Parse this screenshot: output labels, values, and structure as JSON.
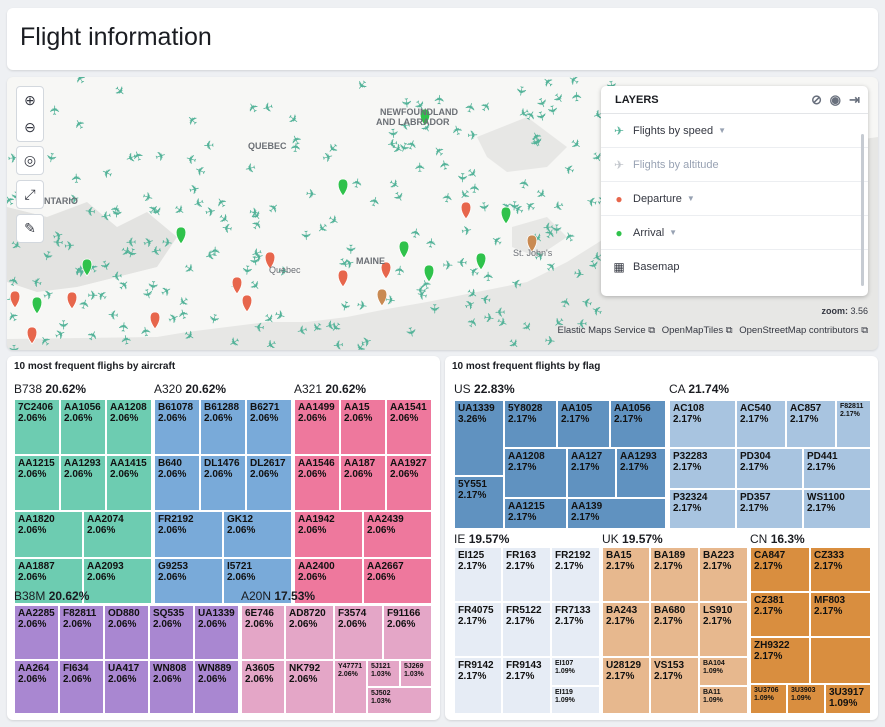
{
  "title": "Flight information",
  "map": {
    "labels": {
      "quebec": "QUEBEC",
      "ontario": "ONTARIO",
      "newfoundland": "NEWFOUNDLAND",
      "labrador": "AND LABRADOR",
      "maine": "MAINE",
      "stjohns": "St. John's",
      "quebec_city": "Quebec"
    },
    "zoom_label": "zoom:",
    "zoom_value": "3.56",
    "attributions": [
      "Elastic Maps Service",
      "OpenMapTiles",
      "OpenStreetMap contributors"
    ],
    "colors": {
      "plane": "#54b399",
      "departure": "#e7664c",
      "arrival": "#2fc24b",
      "water": "#e7e7e5",
      "land": "#f7f7f5"
    }
  },
  "layers": {
    "title": "LAYERS",
    "items": [
      {
        "label": "Flights by speed",
        "icon": "plane-icon"
      },
      {
        "label": "Flights by altitude",
        "icon": "plane-icon"
      },
      {
        "label": "Departure",
        "icon": "map-pin-icon"
      },
      {
        "label": "Arrival",
        "icon": "map-pin-icon"
      },
      {
        "label": "Basemap",
        "icon": "grid-icon"
      }
    ]
  },
  "aircraft": {
    "title": "10 most frequent flighs by aircraft",
    "groups": [
      {
        "name": "B738",
        "pct": "20.62%",
        "color": "#6dccb1",
        "cells": [
          {
            "l": "7C2406",
            "v": "2.06%"
          },
          {
            "l": "AA1056",
            "v": "2.06%"
          },
          {
            "l": "AA1208",
            "v": "2.06%"
          },
          {
            "l": "AA1215",
            "v": "2.06%"
          },
          {
            "l": "AA1293",
            "v": "2.06%"
          },
          {
            "l": "AA1415",
            "v": "2.06%"
          },
          {
            "l": "AA1820",
            "v": "2.06%"
          },
          {
            "l": "AA2074",
            "v": "2.06%"
          },
          {
            "l": "AA1887",
            "v": "2.06%"
          },
          {
            "l": "AA2093",
            "v": "2.06%"
          }
        ]
      },
      {
        "name": "A320",
        "pct": "20.62%",
        "color": "#79aad9",
        "cells": [
          {
            "l": "B61078",
            "v": "2.06%"
          },
          {
            "l": "B61288",
            "v": "2.06%"
          },
          {
            "l": "B6271",
            "v": "2.06%"
          },
          {
            "l": "B640",
            "v": "2.06%"
          },
          {
            "l": "DL1476",
            "v": "2.06%"
          },
          {
            "l": "DL2617",
            "v": "2.06%"
          },
          {
            "l": "FR2192",
            "v": "2.06%"
          },
          {
            "l": "GK12",
            "v": "2.06%"
          },
          {
            "l": "G9253",
            "v": "2.06%"
          },
          {
            "l": "I5721",
            "v": "2.06%"
          }
        ]
      },
      {
        "name": "A321",
        "pct": "20.62%",
        "color": "#ee789d",
        "cells": [
          {
            "l": "AA1499",
            "v": "2.06%"
          },
          {
            "l": "AA15",
            "v": "2.06%"
          },
          {
            "l": "AA1541",
            "v": "2.06%"
          },
          {
            "l": "AA1546",
            "v": "2.06%"
          },
          {
            "l": "AA187",
            "v": "2.06%"
          },
          {
            "l": "AA1927",
            "v": "2.06%"
          },
          {
            "l": "AA1942",
            "v": "2.06%"
          },
          {
            "l": "AA2439",
            "v": "2.06%"
          },
          {
            "l": "AA2400",
            "v": "2.06%"
          },
          {
            "l": "AA2667",
            "v": "2.06%"
          }
        ]
      },
      {
        "name": "B38M",
        "pct": "20.62%",
        "color": "#a987d1",
        "cells": [
          {
            "l": "AA2285",
            "v": "2.06%"
          },
          {
            "l": "F82811",
            "v": "2.06%"
          },
          {
            "l": "OD880",
            "v": "2.06%"
          },
          {
            "l": "SQ535",
            "v": "2.06%"
          },
          {
            "l": "UA1339",
            "v": "2.06%"
          },
          {
            "l": "AA264",
            "v": "2.06%"
          },
          {
            "l": "FI634",
            "v": "2.06%"
          },
          {
            "l": "UA417",
            "v": "2.06%"
          },
          {
            "l": "WN808",
            "v": "2.06%"
          },
          {
            "l": "WN889",
            "v": "2.06%"
          }
        ]
      },
      {
        "name": "A20N",
        "pct": "17.53%",
        "color": "#e4a6c7",
        "cells": [
          {
            "l": "6E746",
            "v": "2.06%"
          },
          {
            "l": "AD8720",
            "v": "2.06%"
          },
          {
            "l": "F3574",
            "v": "2.06%"
          },
          {
            "l": "F91166",
            "v": "2.06%"
          },
          {
            "l": "NK792",
            "v": "2.06%"
          },
          {
            "l": "Y47771",
            "v": "2.06%"
          },
          {
            "l": "5J121",
            "v": "1.03%"
          },
          {
            "l": "5J269",
            "v": "1.03%"
          },
          {
            "l": "A3605",
            "v": "2.06%"
          },
          {
            "l": "5J502",
            "v": "1.03%"
          }
        ]
      }
    ]
  },
  "flag": {
    "title": "10 most frequent flights by flag",
    "groups": [
      {
        "name": "US",
        "pct": "22.83%",
        "color": "#6092c0",
        "cells": [
          {
            "l": "UA1339",
            "v": "3.26%"
          },
          {
            "l": "5Y8028",
            "v": "2.17%"
          },
          {
            "l": "AA105",
            "v": "2.17%"
          },
          {
            "l": "AA1056",
            "v": "2.17%"
          },
          {
            "l": "AA1208",
            "v": "2.17%"
          },
          {
            "l": "AA127",
            "v": "2.17%"
          },
          {
            "l": "AA1293",
            "v": "2.17%"
          },
          {
            "l": "5Y551",
            "v": "2.17%"
          },
          {
            "l": "AA1215",
            "v": "2.17%"
          },
          {
            "l": "AA139",
            "v": "2.17%"
          }
        ]
      },
      {
        "name": "CA",
        "pct": "21.74%",
        "color": "#a8c4e0",
        "cells": [
          {
            "l": "AC108",
            "v": "2.17%"
          },
          {
            "l": "AC540",
            "v": "2.17%"
          },
          {
            "l": "AC857",
            "v": "2.17%"
          },
          {
            "l": "F82811",
            "v": "2.17%"
          },
          {
            "l": "P32283",
            "v": "2.17%"
          },
          {
            "l": "PD304",
            "v": "2.17%"
          },
          {
            "l": "PD441",
            "v": "2.17%"
          },
          {
            "l": "P32324",
            "v": "2.17%"
          },
          {
            "l": "PD357",
            "v": "2.17%"
          },
          {
            "l": "WS1100",
            "v": "2.17%"
          }
        ]
      },
      {
        "name": "IE",
        "pct": "19.57%",
        "color": "#e6ecf5",
        "cells": [
          {
            "l": "EI125",
            "v": "2.17%"
          },
          {
            "l": "FR163",
            "v": "2.17%"
          },
          {
            "l": "FR2192",
            "v": "2.17%"
          },
          {
            "l": "FR4075",
            "v": "2.17%"
          },
          {
            "l": "FR5122",
            "v": "2.17%"
          },
          {
            "l": "FR7133",
            "v": "2.17%"
          },
          {
            "l": "FR9142",
            "v": "2.17%"
          },
          {
            "l": "FR9143",
            "v": "2.17%"
          },
          {
            "l": "EI107",
            "v": "1.09%"
          },
          {
            "l": "EI119",
            "v": "1.09%"
          }
        ]
      },
      {
        "name": "UK",
        "pct": "19.57%",
        "color": "#e7b88e",
        "cells": [
          {
            "l": "BA15",
            "v": "2.17%"
          },
          {
            "l": "BA189",
            "v": "2.17%"
          },
          {
            "l": "BA223",
            "v": "2.17%"
          },
          {
            "l": "BA243",
            "v": "2.17%"
          },
          {
            "l": "BA680",
            "v": "2.17%"
          },
          {
            "l": "LS910",
            "v": "2.17%"
          },
          {
            "l": "U28129",
            "v": "2.17%"
          },
          {
            "l": "VS153",
            "v": "2.17%"
          },
          {
            "l": "BA104",
            "v": "1.09%"
          },
          {
            "l": "BA11",
            "v": "1.09%"
          }
        ]
      },
      {
        "name": "CN",
        "pct": "16.3%",
        "color": "#d98e3f",
        "cells": [
          {
            "l": "CA847",
            "v": "2.17%"
          },
          {
            "l": "CZ333",
            "v": "2.17%"
          },
          {
            "l": "CZ381",
            "v": "2.17%"
          },
          {
            "l": "MF803",
            "v": "2.17%"
          },
          {
            "l": "ZH9322",
            "v": "2.17%"
          },
          {
            "l": "",
            "v": ""
          },
          {
            "l": "3U3706",
            "v": "1.09%"
          },
          {
            "l": "3U3903",
            "v": "1.09%"
          },
          {
            "l": "3U3917",
            "v": "1.09%"
          },
          {
            "l": "",
            "v": ""
          }
        ]
      }
    ]
  }
}
